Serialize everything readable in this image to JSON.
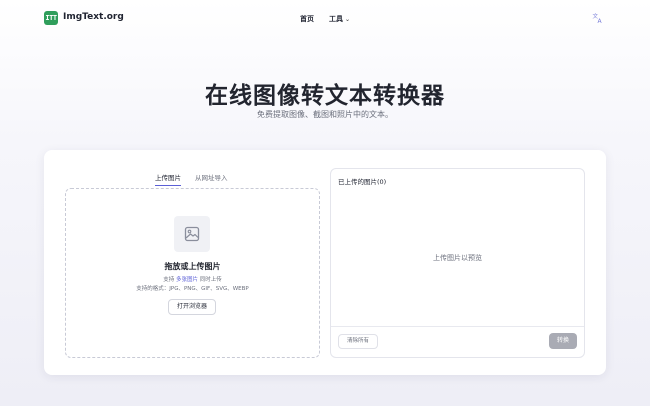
{
  "header": {
    "logo_text": "ITT",
    "brand": "ImgText.org",
    "nav": {
      "home": "首页",
      "tools": "工具"
    }
  },
  "hero": {
    "title": "在线图像转文本转换器",
    "subtitle": "免费提取图像、截图和照片中的文本。"
  },
  "upload": {
    "tabs": {
      "upload": "上传图片",
      "url": "从网址导入"
    },
    "title": "拖放或上传图片",
    "support_prefix": "支持 ",
    "support_highlight": "多张图片",
    "support_suffix": " 同时上传",
    "formats": "支持的格式：JPG、PNG、GIF、SVG、WEBP",
    "browse_label": "打开浏览器"
  },
  "panel": {
    "title": "已上传的图片(0)",
    "empty_text": "上传图片以预览",
    "clear_label": "清除所有",
    "convert_label": "转换"
  },
  "colors": {
    "brand_green": "#2f9e5b",
    "accent": "#5b5fd6",
    "convert_disabled": "#a9abb4"
  },
  "icons": {
    "logo": "logo-icon",
    "language": "translate-icon",
    "image_placeholder": "image-icon",
    "dropdown": "chevron-down-icon"
  }
}
